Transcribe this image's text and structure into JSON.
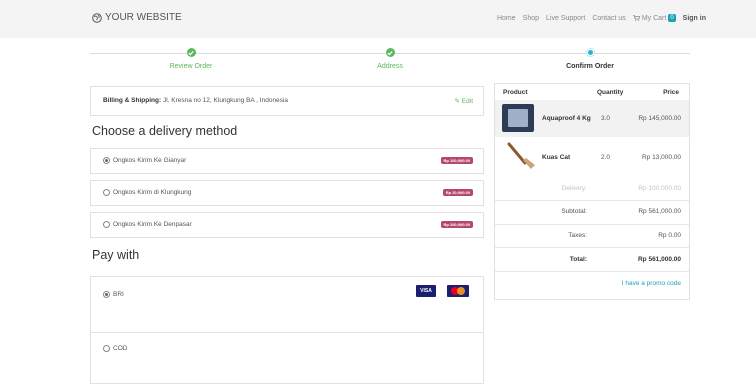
{
  "header": {
    "brand": "YOUR WEBSITE",
    "nav": [
      "Home",
      "Shop",
      "Live Support",
      "Contact us"
    ],
    "cart_label": "My Cart",
    "cart_count": "0",
    "signin": "Sign in"
  },
  "steps": [
    {
      "label": "Review Order",
      "status": "done"
    },
    {
      "label": "Address",
      "status": "done"
    },
    {
      "label": "Confirm Order",
      "status": "current"
    }
  ],
  "billing": {
    "label": "Billing & Shipping:",
    "address": "Jl. Kresna no 12, Klungkung BA , Indonesia",
    "edit": "Edit"
  },
  "delivery": {
    "title": "Choose a delivery method",
    "options": [
      {
        "label": "Ongkos Kirim Ke Gianyar",
        "price": "Rp 100,000.00",
        "selected": true
      },
      {
        "label": "Ongkos Kirim di Klungkung",
        "price": "Rp 20,000.00",
        "selected": false
      },
      {
        "label": "Ongkos Kirim Ke Denpasar",
        "price": "Rp 200,000.00",
        "selected": false
      }
    ]
  },
  "payment": {
    "title": "Pay with",
    "options": [
      {
        "label": "BRI",
        "selected": true
      },
      {
        "label": "COD",
        "selected": false
      }
    ],
    "card_visa": "VISA"
  },
  "summary": {
    "headers": {
      "product": "Product",
      "quantity": "Quantity",
      "price": "Price"
    },
    "items": [
      {
        "name": "Aquaproof 4 Kg",
        "qty": "3.0",
        "price": "Rp 145,000.00"
      },
      {
        "name": "Kuas Cat",
        "qty": "2.0",
        "price": "Rp 13,000.00"
      }
    ],
    "delivery_label": "Delivery:",
    "delivery_value": "Rp 100,000.00",
    "subtotal_label": "Subtotal:",
    "subtotal_value": "Rp 561,000.00",
    "taxes_label": "Taxes:",
    "taxes_value": "Rp 0.00",
    "total_label": "Total:",
    "total_value": "Rp 561,000.00",
    "promo": "I have a promo code"
  },
  "colors": {
    "accent_green": "#5cb85c",
    "accent_teal": "#1aa3b8",
    "price_badge": "#b5486f"
  }
}
